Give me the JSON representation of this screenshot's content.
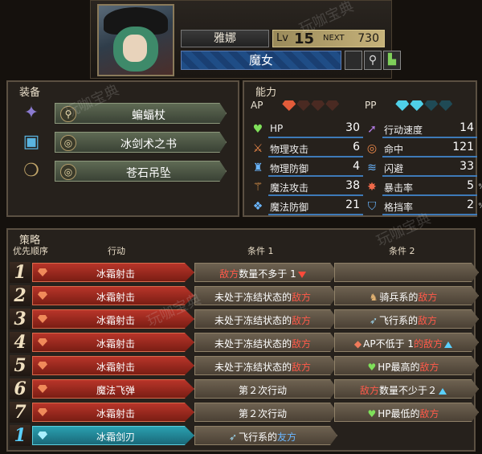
{
  "character": {
    "name": "雅娜",
    "level_label": "Lv",
    "level": "15",
    "next_label": "NEXT",
    "next_value": "730",
    "class": "魔女"
  },
  "equipment": {
    "title": "装备",
    "items": [
      {
        "name": "蝙蝠杖",
        "icon": "wand-icon"
      },
      {
        "name": "冰剑术之书",
        "icon": "book-icon"
      },
      {
        "name": "苍石吊坠",
        "icon": "pendant-icon"
      }
    ]
  },
  "abilities": {
    "title": "能力",
    "ap_label": "AP",
    "pp_label": "PP",
    "ap_filled": 1,
    "ap_total": 4,
    "pp_filled": 2,
    "pp_total": 4,
    "left": [
      {
        "label": "HP",
        "value": "30",
        "unit": "",
        "icon": "heart-icon"
      },
      {
        "label": "物理攻击",
        "value": "6",
        "unit": "",
        "icon": "sword-icon"
      },
      {
        "label": "物理防御",
        "value": "4",
        "unit": "",
        "icon": "armor-icon"
      },
      {
        "label": "魔法攻击",
        "value": "38",
        "unit": "",
        "icon": "wand-icon"
      },
      {
        "label": "魔法防御",
        "value": "21",
        "unit": "",
        "icon": "magic-shield-icon"
      }
    ],
    "right": [
      {
        "label": "行动速度",
        "value": "14",
        "unit": "",
        "icon": "speed-icon"
      },
      {
        "label": "命中",
        "value": "121",
        "unit": "",
        "icon": "target-icon"
      },
      {
        "label": "闪避",
        "value": "33",
        "unit": "",
        "icon": "evade-icon"
      },
      {
        "label": "暴击率",
        "value": "5",
        "unit": "%",
        "icon": "crit-icon"
      },
      {
        "label": "格挡率",
        "value": "2",
        "unit": "%",
        "icon": "block-icon"
      }
    ]
  },
  "strategy": {
    "title": "策略",
    "col_priority": "优先顺序",
    "col_action": "行动",
    "col_cond1": "条件 1",
    "col_cond2": "条件 2",
    "rules": [
      {
        "num": "1",
        "type": "ap",
        "action": "冰霜射击",
        "c1": {
          "pre": "",
          "hl": "敌方",
          "post": "数量不多于 1",
          "hl2": "",
          "icon": "",
          "tri": "down"
        },
        "c2": {
          "pre": "",
          "hl": "",
          "post": "",
          "hl2": "",
          "icon": "",
          "tri": ""
        }
      },
      {
        "num": "2",
        "type": "ap",
        "action": "冰霜射击",
        "c1": {
          "pre": "未处于冻结状态的",
          "hl": "敌方",
          "post": "",
          "hl2": "",
          "icon": "",
          "tri": ""
        },
        "c2": {
          "pre": "骑兵系的",
          "hl": "敌方",
          "post": "",
          "hl2": "",
          "icon": "horse",
          "tri": ""
        }
      },
      {
        "num": "3",
        "type": "ap",
        "action": "冰霜射击",
        "c1": {
          "pre": "未处于冻结状态的",
          "hl": "敌方",
          "post": "",
          "hl2": "",
          "icon": "",
          "tri": ""
        },
        "c2": {
          "pre": "飞行系的",
          "hl": "敌方",
          "post": "",
          "hl2": "",
          "icon": "wing",
          "tri": ""
        }
      },
      {
        "num": "4",
        "type": "ap",
        "action": "冰霜射击",
        "c1": {
          "pre": "未处于冻结状态的",
          "hl": "敌方",
          "post": "",
          "hl2": "",
          "icon": "",
          "tri": ""
        },
        "c2": {
          "pre": "AP不低于 1",
          "hl": "的敌方",
          "post": "",
          "hl2": "",
          "icon": "gem",
          "tri": "up"
        }
      },
      {
        "num": "5",
        "type": "ap",
        "action": "冰霜射击",
        "c1": {
          "pre": "未处于冻结状态的",
          "hl": "敌方",
          "post": "",
          "hl2": "",
          "icon": "",
          "tri": ""
        },
        "c2": {
          "pre": "HP最高的",
          "hl": "敌方",
          "post": "",
          "hl2": "",
          "icon": "heart",
          "tri": ""
        }
      },
      {
        "num": "6",
        "type": "ap",
        "action": "魔法飞弹",
        "c1": {
          "pre": "第２次行动",
          "hl": "",
          "post": "",
          "hl2": "",
          "icon": "",
          "tri": ""
        },
        "c2": {
          "pre": "",
          "hl": "敌方",
          "post": "数量不少于２",
          "hl2": "",
          "icon": "",
          "tri": "up"
        }
      },
      {
        "num": "7",
        "type": "ap",
        "action": "冰霜射击",
        "c1": {
          "pre": "第２次行动",
          "hl": "",
          "post": "",
          "hl2": "",
          "icon": "",
          "tri": ""
        },
        "c2": {
          "pre": "HP最低的",
          "hl": "敌方",
          "post": "",
          "hl2": "",
          "icon": "heart",
          "tri": ""
        }
      },
      {
        "num": "1",
        "type": "pp",
        "action": "冰霜剑刃",
        "c1": {
          "pre": "飞行系的",
          "hl": "",
          "post": "",
          "hl2": "友方",
          "icon": "wing",
          "tri": ""
        },
        "c2": {
          "pre": "",
          "hl": "",
          "post": "",
          "hl2": "",
          "icon": "",
          "tri": ""
        }
      }
    ]
  },
  "watermark": "玩咖宝典"
}
